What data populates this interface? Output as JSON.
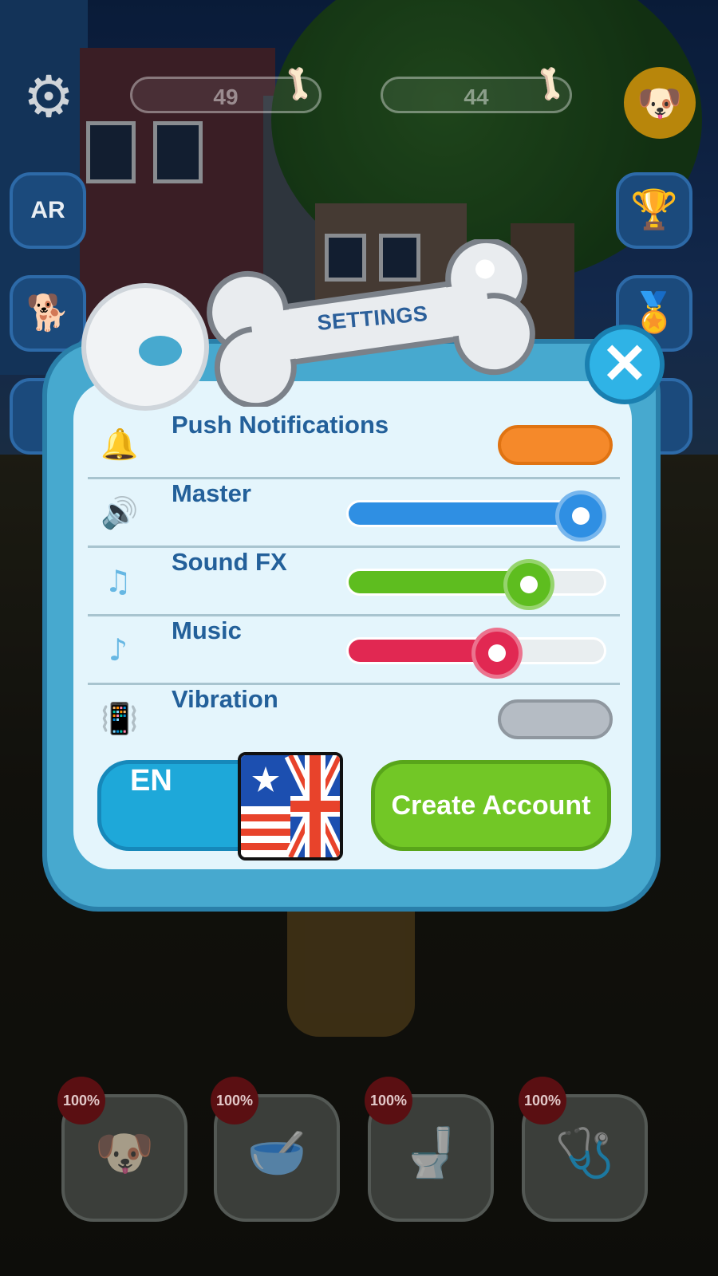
{
  "hud": {
    "bones_counter_1": "49",
    "bones_counter_2": "44",
    "ar_button_label": "AR"
  },
  "settings": {
    "title": "SETTINGS",
    "rows": [
      {
        "label": "Push Notifications",
        "icon": "bell-icon",
        "control": "toggle",
        "on": true,
        "color": "#f5892a"
      },
      {
        "label": "Master",
        "icon": "speaker-icon",
        "control": "slider",
        "value_percent": 100,
        "color": "#2f8fe3"
      },
      {
        "label": "Sound FX",
        "icon": "music-notes-icon",
        "control": "slider",
        "value_percent": 75,
        "color": "#5ebd1f"
      },
      {
        "label": "Music",
        "icon": "music-note-icon",
        "control": "slider",
        "value_percent": 60,
        "color": "#e12852"
      },
      {
        "label": "Vibration",
        "icon": "vibration-phone-icon",
        "control": "toggle",
        "on": false,
        "color": "#b5bcc4"
      }
    ],
    "language_button": "EN",
    "create_account_button": "Create Account"
  },
  "needs": [
    {
      "badge": "100%",
      "icon": "dog-face-icon"
    },
    {
      "badge": "100%",
      "icon": "food-bowl-icon"
    },
    {
      "badge": "100%",
      "icon": "bathroom-icon"
    },
    {
      "badge": "100%",
      "icon": "first-aid-kit-icon"
    }
  ]
}
